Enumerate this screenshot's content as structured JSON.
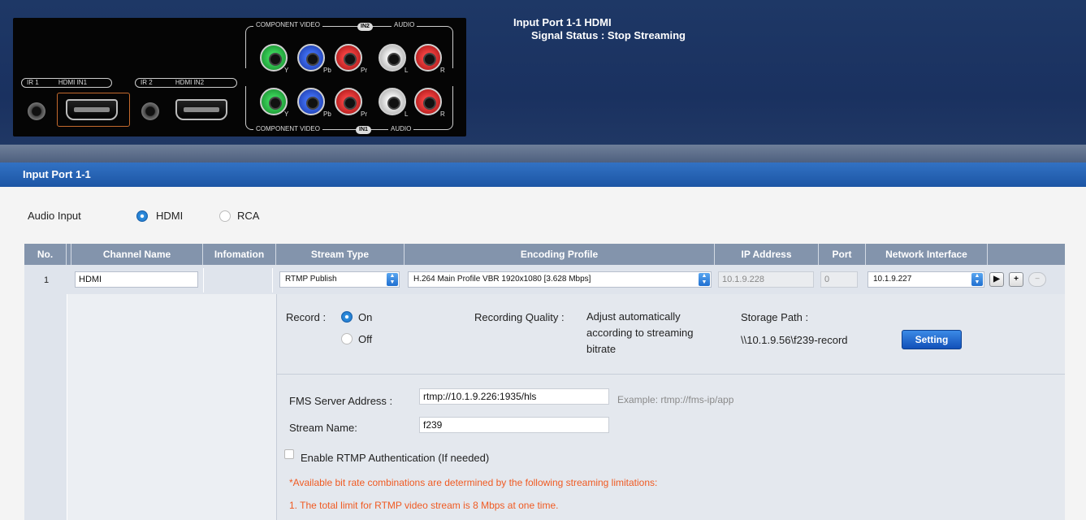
{
  "panel": {
    "ir1": "IR 1",
    "hdmi_in1": "HDMI IN1",
    "ir2": "IR 2",
    "hdmi_in2": "HDMI IN2",
    "component_video": "COMPONENT VIDEO",
    "audio": "AUDIO",
    "in2": "IN2",
    "in1": "IN1",
    "y": "Y",
    "pb": "Pb",
    "pr": "Pr",
    "l": "L",
    "r": "R"
  },
  "header": {
    "port_title": "Input Port 1-1  HDMI",
    "signal_status": "Signal Status : Stop Streaming"
  },
  "section": {
    "title": "Input Port 1-1"
  },
  "audio_input": {
    "label": "Audio Input",
    "options": [
      "HDMI",
      "RCA"
    ],
    "selected": "HDMI"
  },
  "table": {
    "headers": [
      "No.",
      "Channel Name",
      "Infomation",
      "Stream Type",
      "Encoding Profile",
      "IP Address",
      "Port",
      "Network Interface"
    ],
    "row": {
      "no": "1",
      "channel_name": "HDMI",
      "stream_type": "RTMP Publish",
      "encoding_profile": "H.264 Main Profile VBR 1920x1080 [3.628 Mbps]",
      "ip_address": "10.1.9.228",
      "port": "0",
      "network_interface": "10.1.9.227"
    }
  },
  "record": {
    "label": "Record :",
    "on": "On",
    "off": "Off",
    "quality_label": "Recording Quality :",
    "quality_value": "Adjust automatically according to streaming bitrate",
    "storage_label": "Storage Path :",
    "storage_value": "\\\\10.1.9.56\\f239-record",
    "setting_button": "Setting"
  },
  "fms": {
    "server_label": "FMS Server Address :",
    "server_value": "rtmp://10.1.9.226:1935/hls",
    "server_example": "Example: rtmp://fms-ip/app",
    "stream_label": "Stream Name:",
    "stream_value": "f239",
    "auth_label": "Enable RTMP Authentication (If needed)",
    "note": "*Available bit rate combinations are determined by the following streaming limitations:",
    "limit1": "1. The total limit for RTMP video stream is 8 Mbps at one time."
  }
}
